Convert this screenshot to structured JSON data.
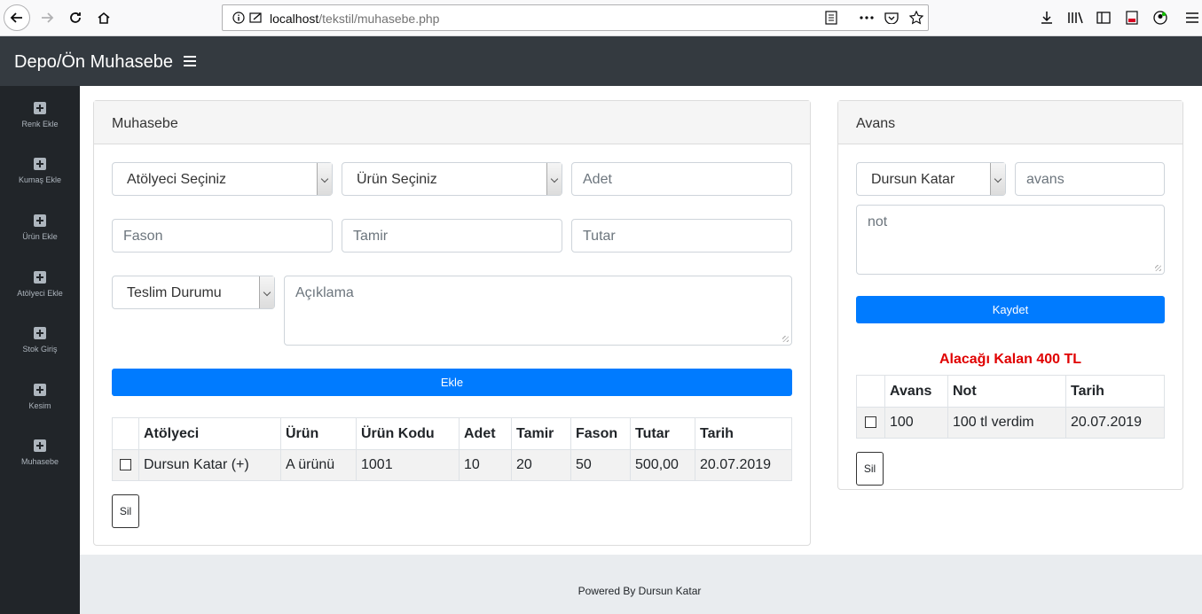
{
  "browser": {
    "url_host": "localhost",
    "url_path": "/tekstil/muhasebe.php"
  },
  "app": {
    "brand": "Depo/Ön Muhasebe"
  },
  "sidebar": {
    "items": [
      {
        "label": "Renk Ekle",
        "icon": "plus-square-icon"
      },
      {
        "label": "Kumaş Ekle",
        "icon": "plus-square-icon"
      },
      {
        "label": "Ürün Ekle",
        "icon": "plus-square-icon"
      },
      {
        "label": "Atölyeci Ekle",
        "icon": "plus-square-icon"
      },
      {
        "label": "Stok Giriş",
        "icon": "plus-square-icon"
      },
      {
        "label": "Kesim",
        "icon": "plus-square-icon"
      },
      {
        "label": "Muhasebe",
        "icon": "plus-square-icon"
      }
    ]
  },
  "muhasebe": {
    "title": "Muhasebe",
    "atolyeci_select": "Atölyeci Seçiniz",
    "urun_select": "Ürün Seçiniz",
    "adet_placeholder": "Adet",
    "fason_placeholder": "Fason",
    "tamir_placeholder": "Tamir",
    "tutar_placeholder": "Tutar",
    "teslim_select": "Teslim Durumu",
    "aciklama_placeholder": "Açıklama",
    "add_label": "Ekle",
    "delete_label": "Sil",
    "table": {
      "headers": [
        "Atölyeci",
        "Ürün",
        "Ürün Kodu",
        "Adet",
        "Tamir",
        "Fason",
        "Tutar",
        "Tarih"
      ],
      "rows": [
        {
          "atolyeci": "Dursun Katar (+)",
          "urun": "A ürünü",
          "kod": "1001",
          "adet": "10",
          "tamir": "20",
          "fason": "50",
          "tutar": "500,00",
          "tarih": "20.07.2019"
        }
      ]
    }
  },
  "avans": {
    "title": "Avans",
    "person_select": "Dursun Katar",
    "avans_placeholder": "avans",
    "not_placeholder": "not",
    "save_label": "Kaydet",
    "remaining_text": "Alacağı Kalan 400 TL",
    "delete_label": "Sil",
    "table": {
      "headers": [
        "Avans",
        "Not",
        "Tarih"
      ],
      "rows": [
        {
          "avans": "100",
          "not": "100 tl verdim",
          "tarih": "20.07.2019"
        }
      ]
    }
  },
  "footer": {
    "text": "Powered By Dursun Katar"
  }
}
